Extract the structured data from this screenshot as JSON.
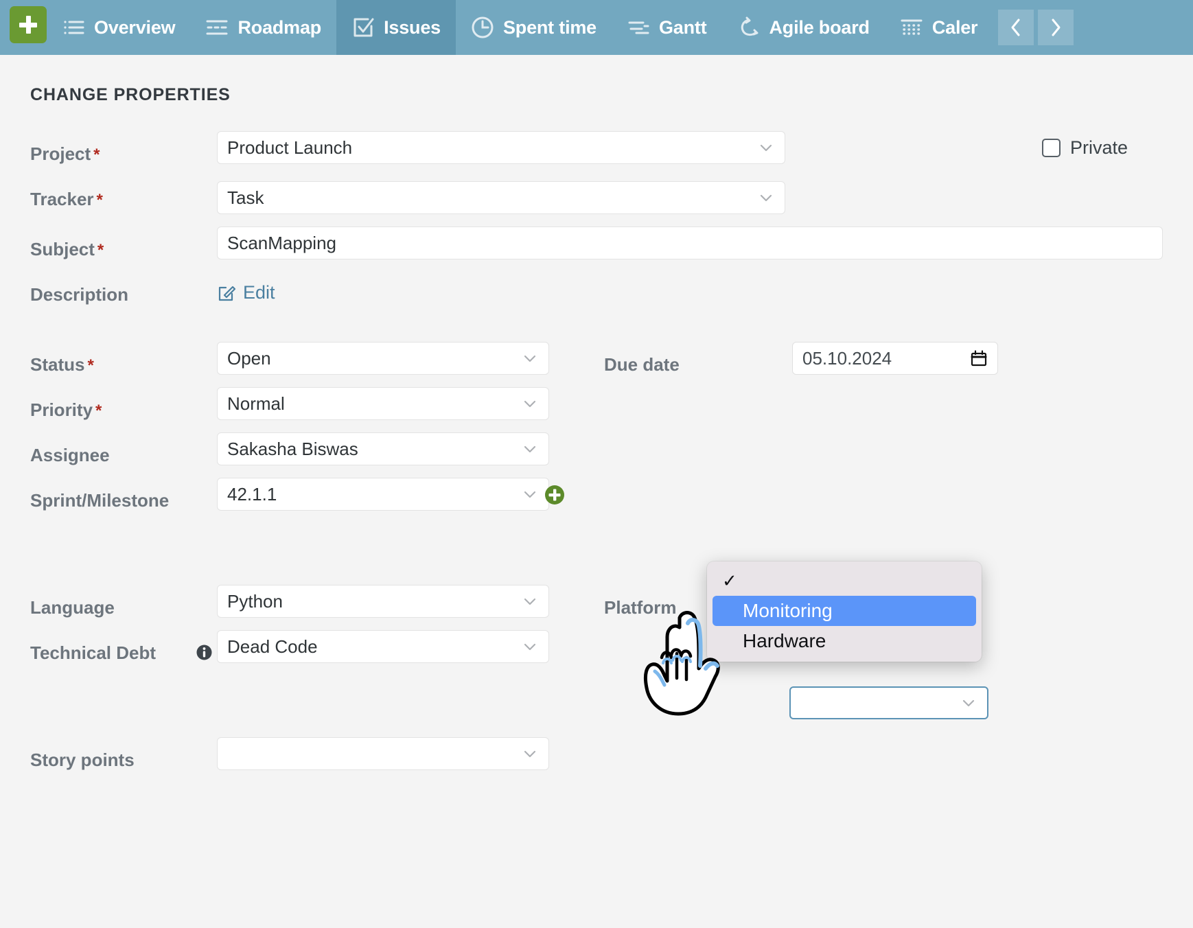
{
  "navbar": {
    "add_button_label": "+",
    "items": [
      {
        "label": "Overview",
        "icon": "list-icon",
        "active": false
      },
      {
        "label": "Roadmap",
        "icon": "roadmap-icon",
        "active": false
      },
      {
        "label": "Issues",
        "icon": "checkbox-list-icon",
        "active": true
      },
      {
        "label": "Spent time",
        "icon": "clock-icon",
        "active": false
      },
      {
        "label": "Gantt",
        "icon": "gantt-icon",
        "active": false
      },
      {
        "label": "Agile board",
        "icon": "refresh-cycle-icon",
        "active": false
      },
      {
        "label": "Caler",
        "icon": "calendar-grid-icon",
        "active": false
      }
    ],
    "prev_arrow": "‹",
    "next_arrow": "›"
  },
  "form": {
    "section_title": "CHANGE PROPERTIES",
    "project": {
      "label": "Project",
      "required": "*",
      "value": "Product Launch"
    },
    "tracker": {
      "label": "Tracker",
      "required": "*",
      "value": "Task"
    },
    "subject": {
      "label": "Subject",
      "required": "*",
      "value": "ScanMapping"
    },
    "description": {
      "label": "Description",
      "edit_label": "Edit"
    },
    "private": {
      "label": "Private",
      "checked": false
    },
    "status": {
      "label": "Status",
      "required": "*",
      "value": "Open"
    },
    "priority": {
      "label": "Priority",
      "required": "*",
      "value": "Normal"
    },
    "assignee": {
      "label": "Assignee",
      "value": "Sakasha Biswas"
    },
    "sprint": {
      "label": "Sprint/Milestone",
      "value": "42.1.1"
    },
    "due_date": {
      "label": "Due date",
      "value": "05.10.2024"
    },
    "language": {
      "label": "Language",
      "value": "Python"
    },
    "technical_debt": {
      "label": "Technical Debt",
      "value": "Dead Code"
    },
    "platform": {
      "label": "Platform",
      "value": ""
    },
    "story_points": {
      "label": "Story points",
      "value": ""
    }
  },
  "dropdown": {
    "name": "platform-options",
    "items": [
      {
        "label": "",
        "checked": true,
        "highlighted": false
      },
      {
        "label": "Monitoring",
        "checked": false,
        "highlighted": true
      },
      {
        "label": "Hardware",
        "checked": false,
        "highlighted": false
      }
    ],
    "check_glyph": "✓"
  },
  "colors": {
    "nav_bg": "#73a8c0",
    "nav_active": "#5f96b0",
    "add_green": "#6a9a32",
    "page_bg": "#f4f4f4",
    "highlight_blue": "#5b95f9",
    "link_blue": "#4a7fa0",
    "required_red": "#b02a1f",
    "focus_border": "#5b93b5"
  }
}
